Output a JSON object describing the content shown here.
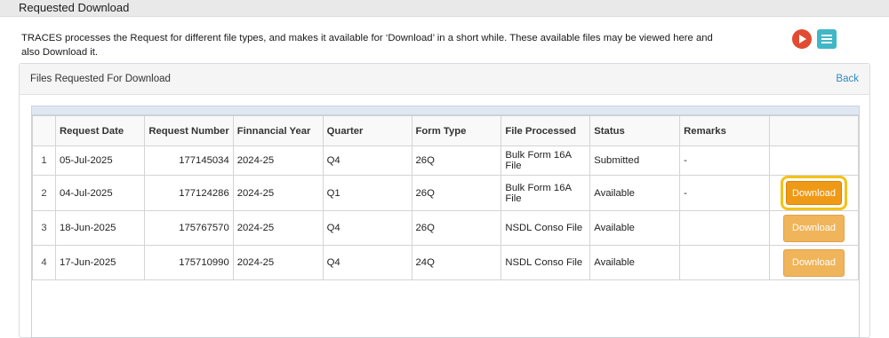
{
  "page": {
    "title": "Requested Download"
  },
  "intro": {
    "text": "TRACES processes the Request for different file types, and makes it available for ‘Download’ in a short while. These available files may be viewed here and also Download it."
  },
  "panel": {
    "title": "Files Requested For Download",
    "back_label": "Back"
  },
  "table": {
    "columns": [
      "Request Date",
      "Request Number",
      "Finnancial Year",
      "Quarter",
      "Form Type",
      "File Processed",
      "Status",
      "Remarks"
    ],
    "rows": [
      {
        "no": "1",
        "request_date": "05-Jul-2025",
        "request_number": "177145034",
        "financial_year": "2024-25",
        "quarter": "Q4",
        "form_type": "26Q",
        "file_processed": "Bulk Form 16A File",
        "status": "Submitted",
        "remarks": "-",
        "action": ""
      },
      {
        "no": "2",
        "request_date": "04-Jul-2025",
        "request_number": "177124286",
        "financial_year": "2024-25",
        "quarter": "Q1",
        "form_type": "26Q",
        "file_processed": "Bulk Form 16A File",
        "status": "Available",
        "remarks": "-",
        "action": "Download"
      },
      {
        "no": "3",
        "request_date": "18-Jun-2025",
        "request_number": "175767570",
        "financial_year": "2024-25",
        "quarter": "Q4",
        "form_type": "26Q",
        "file_processed": "NSDL Conso File",
        "status": "Available",
        "remarks": "",
        "action": "Download"
      },
      {
        "no": "4",
        "request_date": "17-Jun-2025",
        "request_number": "175710990",
        "financial_year": "2024-25",
        "quarter": "Q4",
        "form_type": "24Q",
        "file_processed": "NSDL Conso File",
        "status": "Available",
        "remarks": "",
        "action": "Download"
      }
    ]
  },
  "colors": {
    "download_button": "#f0b45a",
    "download_button_active": "#ef9a17",
    "highlight": "#f4c218",
    "play_icon": "#e04b32",
    "list_icon": "#3fb7c6"
  },
  "icons": {
    "play": "play-icon",
    "list": "list-icon"
  }
}
